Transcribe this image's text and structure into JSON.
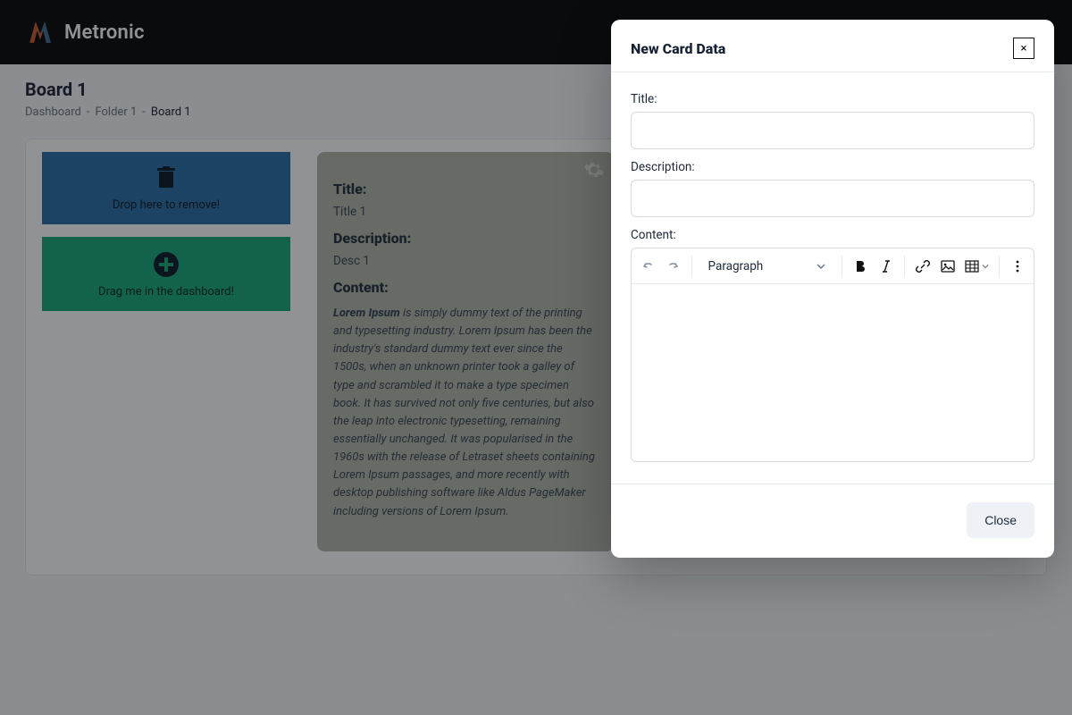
{
  "brand": {
    "name": "Metronic"
  },
  "page": {
    "title": "Board 1",
    "breadcrumbs": [
      "Dashboard",
      "Folder 1",
      "Board 1"
    ]
  },
  "tiles": {
    "remove_label": "Drop here to remove!",
    "drag_label": "Drag me in the dashboard!"
  },
  "card": {
    "title_label": "Title:",
    "title_value": "Title 1",
    "desc_label": "Description:",
    "desc_value": "Desc 1",
    "content_label": "Content:",
    "content_lead": "Lorem Ipsum",
    "content_body": " is simply dummy text of the printing and typesetting industry. Lorem Ipsum has been the industry's standard dummy text ever since the 1500s, when an unknown printer took a galley of type and scrambled it to make a type specimen book. It has survived not only five centuries, but also the leap into electronic typesetting, remaining essentially unchanged. It was popularised in the 1960s with the release of Letraset sheets containing Lorem Ipsum passages, and more recently with desktop publishing software like Aldus PageMaker including versions of Lorem Ipsum."
  },
  "modal": {
    "title": "New Card Data",
    "fields": {
      "title_label": "Title:",
      "desc_label": "Description:",
      "content_label": "Content:"
    },
    "toolbar": {
      "paragraph_label": "Paragraph"
    },
    "close_label": "Close"
  }
}
